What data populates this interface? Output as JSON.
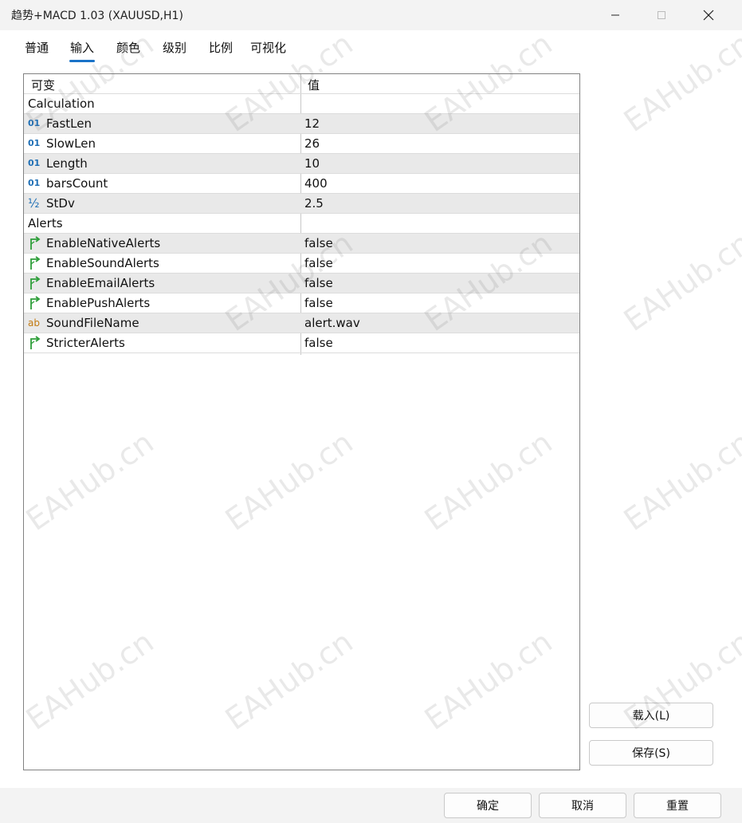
{
  "window": {
    "title": "趋势+MACD 1.03 (XAUUSD,H1)"
  },
  "tabs": [
    {
      "label": "普通"
    },
    {
      "label": "输入"
    },
    {
      "label": "颜色"
    },
    {
      "label": "级别"
    },
    {
      "label": "比例"
    },
    {
      "label": "可视化"
    }
  ],
  "active_tab": "输入",
  "grid": {
    "header": {
      "name": "可变",
      "value": "值"
    },
    "rows": [
      {
        "type": "group",
        "name": "Calculation",
        "value": ""
      },
      {
        "type": "int",
        "icon": "integer-icon",
        "icon_text": "01",
        "name": "FastLen",
        "value": "12"
      },
      {
        "type": "int",
        "icon": "integer-icon",
        "icon_text": "01",
        "name": "SlowLen",
        "value": "26"
      },
      {
        "type": "int",
        "icon": "integer-icon",
        "icon_text": "01",
        "name": "Length",
        "value": "10"
      },
      {
        "type": "int",
        "icon": "integer-icon",
        "icon_text": "01",
        "name": "barsCount",
        "value": "400"
      },
      {
        "type": "double",
        "icon": "fraction-icon",
        "icon_text": "½",
        "name": "StDv",
        "value": "2.5"
      },
      {
        "type": "group",
        "name": "Alerts",
        "value": ""
      },
      {
        "type": "bool",
        "icon": "bool-arrow-icon",
        "name": "EnableNativeAlerts",
        "value": "false"
      },
      {
        "type": "bool",
        "icon": "bool-arrow-icon",
        "name": "EnableSoundAlerts",
        "value": "false"
      },
      {
        "type": "bool",
        "icon": "bool-arrow-icon",
        "name": "EnableEmailAlerts",
        "value": "false"
      },
      {
        "type": "bool",
        "icon": "bool-arrow-icon",
        "name": "EnablePushAlerts",
        "value": "false"
      },
      {
        "type": "string",
        "icon": "string-icon",
        "icon_text": "ab",
        "name": "SoundFileName",
        "value": "alert.wav"
      },
      {
        "type": "bool",
        "icon": "bool-arrow-icon",
        "name": "StricterAlerts",
        "value": "false"
      }
    ]
  },
  "side_buttons": {
    "load": "载入(L)",
    "save": "保存(S)"
  },
  "footer_buttons": {
    "ok": "确定",
    "cancel": "取消",
    "reset": "重置"
  },
  "watermark_text": "EAHub.cn",
  "colors": {
    "accent": "#1a73c8",
    "int_icon": "#1f6fb5",
    "bool_icon": "#2e9e3a",
    "string_icon": "#c27a12"
  }
}
